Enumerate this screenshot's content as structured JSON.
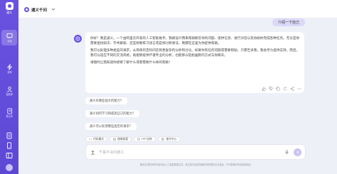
{
  "app": {
    "name": "通义",
    "accent": "#6a52e0"
  },
  "header": {
    "title": "通义千问"
  },
  "sidebar": {
    "items": [
      {
        "label": "对话",
        "icon": "chat-icon"
      },
      {
        "label": "效率",
        "icon": "lightning-icon"
      },
      {
        "label": "智能体",
        "icon": "agent-icon"
      },
      {
        "label": "笔记本",
        "icon": "notebook-icon"
      }
    ]
  },
  "conversation": {
    "user_message": "介绍一下自己",
    "assistant_paragraphs": [
      "你好！我是通义，一个由阿里云开发的人工智能助手。我被设计用来帮助解答你的问题、提供信息、进行对话以及协助你完成各种任务。无论是你需要查找知识、学术解惑、还是想要练习语言或是探讨新想法，我都在这里为你提供帮助。",
      "我可以处理多种类型的请求，从简单的百科问答到更复杂的分析和讨论。如果你有任何问题或需要帮助，只需告诉我，我会尽力提供支持。而且，我可以适应不同的交流风格，既能够提供严谨专业的分析，也能够以轻松幽默的方式与你聊天。",
      "请随时让我知道你想要了解什么或者需要什么样的帮助！"
    ]
  },
  "suggestions": [
    "通义有哪些强大的能力？",
    "通义如何学习和提高自己的能力？",
    "通义可以处理哪些类型的请求？"
  ],
  "toolbar": {
    "chips": [
      {
        "label": "代码模式",
        "icon": "code-icon"
      },
      {
        "label": "图像搜索",
        "icon": "image-icon"
      },
      {
        "label": "PPT创作",
        "icon": "slides-icon"
      },
      {
        "label": "指令中心",
        "icon": "command-icon"
      }
    ]
  },
  "input": {
    "placeholder": "千事不决问通义"
  },
  "footer": {
    "text": "服务生成的所有内容均由人工智能模型生成，其生成内容的准确性和完整性无法保证，不代表我们的态度或观点"
  }
}
